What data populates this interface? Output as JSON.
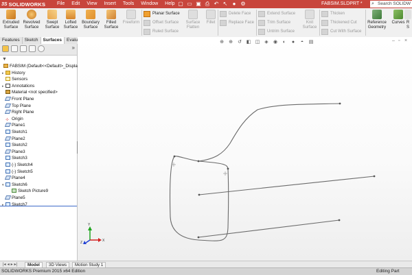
{
  "app": {
    "logo_text": "SOLIDWORKS",
    "menus": [
      "File",
      "Edit",
      "View",
      "Insert",
      "Tools",
      "Window",
      "Help"
    ],
    "document_title": "FABSIM.SLDPRT *",
    "search_placeholder": "Search SOLIDW"
  },
  "command_manager": {
    "big_buttons": [
      {
        "label_1": "Extruded",
        "label_2": "Surface",
        "enabled": true,
        "icon": "extruded-surface-icon"
      },
      {
        "label_1": "Revolved",
        "label_2": "Surface",
        "enabled": true,
        "icon": "revolved-surface-icon"
      },
      {
        "label_1": "Swept",
        "label_2": "Surface",
        "enabled": true,
        "icon": "swept-surface-icon"
      },
      {
        "label_1": "Lofted",
        "label_2": "Surface",
        "enabled": true,
        "icon": "lofted-surface-icon"
      },
      {
        "label_1": "Boundary",
        "label_2": "Surface",
        "enabled": true,
        "icon": "boundary-surface-icon"
      },
      {
        "label_1": "Filled",
        "label_2": "Surface",
        "enabled": true,
        "icon": "filled-surface-icon"
      },
      {
        "label_1": "Freeform",
        "label_2": "",
        "enabled": false,
        "icon": "freeform-icon"
      }
    ],
    "col1": [
      {
        "label": "Planar Surface",
        "enabled": true
      },
      {
        "label": "Offset Surface",
        "enabled": false
      },
      {
        "label": "Ruled Surface",
        "enabled": false
      }
    ],
    "flatten": {
      "label_1": "Surface",
      "label_2": "Flatten"
    },
    "fillet": {
      "label": "Fillet"
    },
    "col2": [
      {
        "label": "Delete Face"
      },
      {
        "label": "Replace Face"
      }
    ],
    "col3": [
      {
        "label": "Extend Surface"
      },
      {
        "label": "Trim Surface"
      },
      {
        "label": "Untrim Surface"
      }
    ],
    "knit": {
      "label_1": "Knit",
      "label_2": "Surface"
    },
    "col4": [
      {
        "label": "Thicken"
      },
      {
        "label": "Thickened Cut"
      },
      {
        "label": "Cut With Surface"
      }
    ],
    "ref_geom": {
      "label_1": "Reference",
      "label_2": "Geometry"
    },
    "curves": {
      "label": "Curves"
    },
    "extra": {
      "label_1": "R",
      "label_2": "S"
    }
  },
  "tabs": [
    "Features",
    "Sketch",
    "Surfaces",
    "Evaluate"
  ],
  "active_tab": "Surfaces",
  "feature_tree": [
    {
      "label": "FABSIM  (Default<<Default>_Displa",
      "icon": "part",
      "indent": 0,
      "expander": ""
    },
    {
      "label": "History",
      "icon": "folder",
      "indent": 1,
      "expander": "▸"
    },
    {
      "label": "Sensors",
      "icon": "sens",
      "indent": 1,
      "expander": ""
    },
    {
      "label": "Annotations",
      "icon": "ann",
      "indent": 1,
      "expander": "▸"
    },
    {
      "label": "Material <not specified>",
      "icon": "mat",
      "indent": 1,
      "expander": ""
    },
    {
      "label": "Front Plane",
      "icon": "plane",
      "indent": 1,
      "expander": ""
    },
    {
      "label": "Top Plane",
      "icon": "plane",
      "indent": 1,
      "expander": ""
    },
    {
      "label": "Right Plane",
      "icon": "plane",
      "indent": 1,
      "expander": ""
    },
    {
      "label": "Origin",
      "icon": "orig",
      "indent": 1,
      "expander": ""
    },
    {
      "label": "Plane1",
      "icon": "plane",
      "indent": 1,
      "expander": ""
    },
    {
      "label": "Sketch1",
      "icon": "sketch",
      "indent": 1,
      "expander": ""
    },
    {
      "label": "Plane2",
      "icon": "plane",
      "indent": 1,
      "expander": ""
    },
    {
      "label": "Sketch2",
      "icon": "sketch",
      "indent": 1,
      "expander": ""
    },
    {
      "label": "Plane3",
      "icon": "plane",
      "indent": 1,
      "expander": ""
    },
    {
      "label": "Sketch3",
      "icon": "sketch",
      "indent": 1,
      "expander": ""
    },
    {
      "label": "(-) Sketch4",
      "icon": "sketch",
      "indent": 1,
      "expander": ""
    },
    {
      "label": "(-) Sketch5",
      "icon": "sketch",
      "indent": 1,
      "expander": ""
    },
    {
      "label": "Plane4",
      "icon": "plane",
      "indent": 1,
      "expander": ""
    },
    {
      "label": "Sketch6",
      "icon": "sketch",
      "indent": 1,
      "expander": "▾"
    },
    {
      "label": "Sketch Picture9",
      "icon": "pic",
      "indent": 2,
      "expander": ""
    },
    {
      "label": "Plane5",
      "icon": "plane",
      "indent": 1,
      "expander": ""
    },
    {
      "label": "Sketch7",
      "icon": "sketch",
      "indent": 1,
      "expander": "▸"
    }
  ],
  "triad": {
    "x_label": "X",
    "y_label": "Y",
    "z_label": "Z"
  },
  "bottom_tabs": [
    "Model",
    "3D Views",
    "Motion Study 1"
  ],
  "active_bottom_tab": "Model",
  "status": {
    "edition": "SOLIDWORKS Premium 2015 x64 Edition",
    "mode": "Editing Part"
  },
  "colors": {
    "brand_red": "#c8453c",
    "sketch_line": "#6a6a6a",
    "active_icon": "#f0a030"
  }
}
